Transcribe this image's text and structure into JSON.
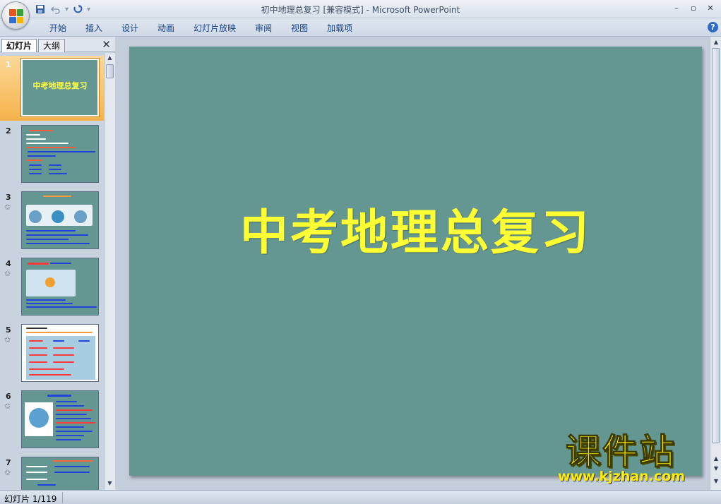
{
  "app": {
    "window_title": "初中地理总复习 [兼容模式] - Microsoft PowerPoint"
  },
  "ribbon": {
    "tabs": [
      "开始",
      "插入",
      "设计",
      "动画",
      "幻灯片放映",
      "审阅",
      "视图",
      "加载项"
    ]
  },
  "left_pane": {
    "tabs": [
      "幻灯片",
      "大纲"
    ],
    "active_tab": "幻灯片",
    "slides": [
      {
        "number": "1",
        "title": "中考地理总复习",
        "selected": true,
        "has_animation": false
      },
      {
        "number": "2",
        "selected": false,
        "has_animation": false
      },
      {
        "number": "3",
        "selected": false,
        "has_animation": true
      },
      {
        "number": "4",
        "title": "地球的运动",
        "selected": false,
        "has_animation": true
      },
      {
        "number": "5",
        "selected": false,
        "has_animation": true
      },
      {
        "number": "6",
        "title": "经线和纬度",
        "selected": false,
        "has_animation": true
      },
      {
        "number": "7",
        "selected": false,
        "has_animation": true
      }
    ]
  },
  "slide": {
    "title": "中考地理总复习",
    "background_color": "#649791",
    "title_color": "#ffff33"
  },
  "watermark": {
    "title": "课件站",
    "url": "www.kjzhan.com"
  },
  "status": {
    "slide_counter": "幻灯片 1/119"
  },
  "icons": {
    "office_button": "office-logo-icon",
    "save": "save-icon",
    "undo": "undo-icon",
    "redo": "redo-icon",
    "customize": "customize-qat-icon",
    "minimize": "minimize-icon",
    "restore": "restore-icon",
    "close": "close-icon",
    "help": "help-icon",
    "pane_close": "close-icon",
    "animation": "animation-star-icon"
  }
}
